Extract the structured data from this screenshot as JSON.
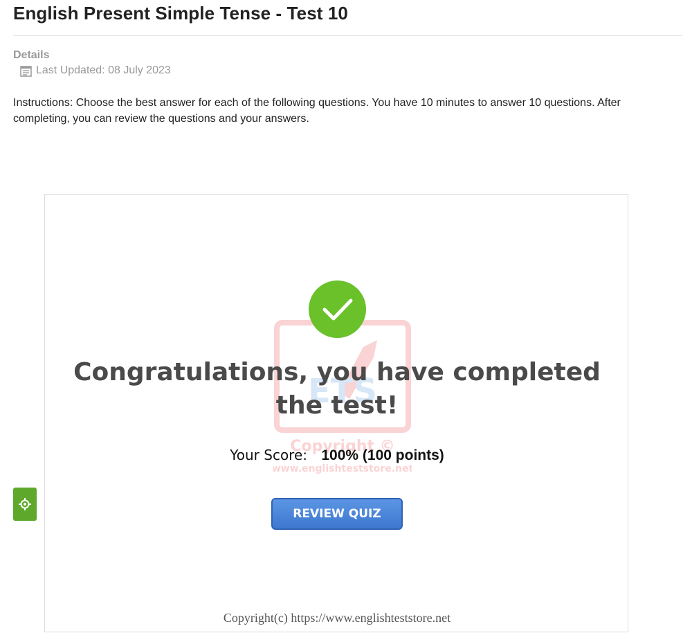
{
  "page": {
    "title": "English Present Simple Tense - Test 10",
    "details_label": "Details",
    "last_updated": "Last Updated: 08 July 2023",
    "instructions": "Instructions: Choose the best answer for each of the following questions. You have 10 minutes to answer 10 questions. After completing, you can review the questions and your answers."
  },
  "quiz": {
    "congrats": "Congratulations, you have completed the test!",
    "score_label": "Your Score:",
    "score_value": "100% (100 points)",
    "review_button": "REVIEW QUIZ",
    "copyright": "Copyright(c) https://www.englishteststore.net",
    "watermark_text": "ETS Copyright ©"
  },
  "icons": {
    "calendar": "calendar-icon",
    "check": "checkmark-icon",
    "gear": "gear-icon"
  },
  "colors": {
    "success_green": "#6ac12a",
    "button_blue": "#4a86da",
    "side_tab_green": "#5ea82b"
  }
}
